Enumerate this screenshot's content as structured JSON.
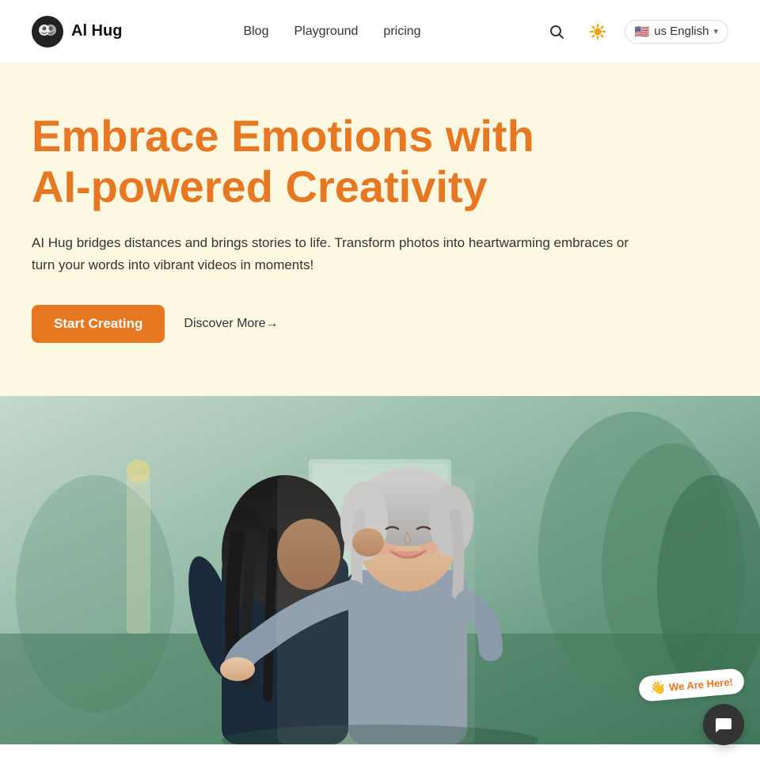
{
  "nav": {
    "logo_text": "Al Hug",
    "links": [
      {
        "label": "Blog",
        "id": "blog"
      },
      {
        "label": "Playground",
        "id": "playground"
      },
      {
        "label": "pricing",
        "id": "pricing"
      }
    ],
    "lang": "us English",
    "lang_chevron": "▾",
    "search_icon": "🔍",
    "theme_icon": "☀"
  },
  "hero": {
    "title": "Embrace Emotions with AI-powered Creativity",
    "subtitle": "AI Hug bridges distances and brings stories to life. Transform photos into heartwarming embraces or turn your words into vibrant videos in moments!",
    "cta_primary": "Start Creating",
    "cta_secondary": "Discover More→"
  },
  "chat": {
    "badge_text": "We Are Here!",
    "hand": "👋",
    "icon": "💬"
  },
  "colors": {
    "orange": "#e87722",
    "hero_bg": "#fdf8e1",
    "text_dark": "#222"
  }
}
